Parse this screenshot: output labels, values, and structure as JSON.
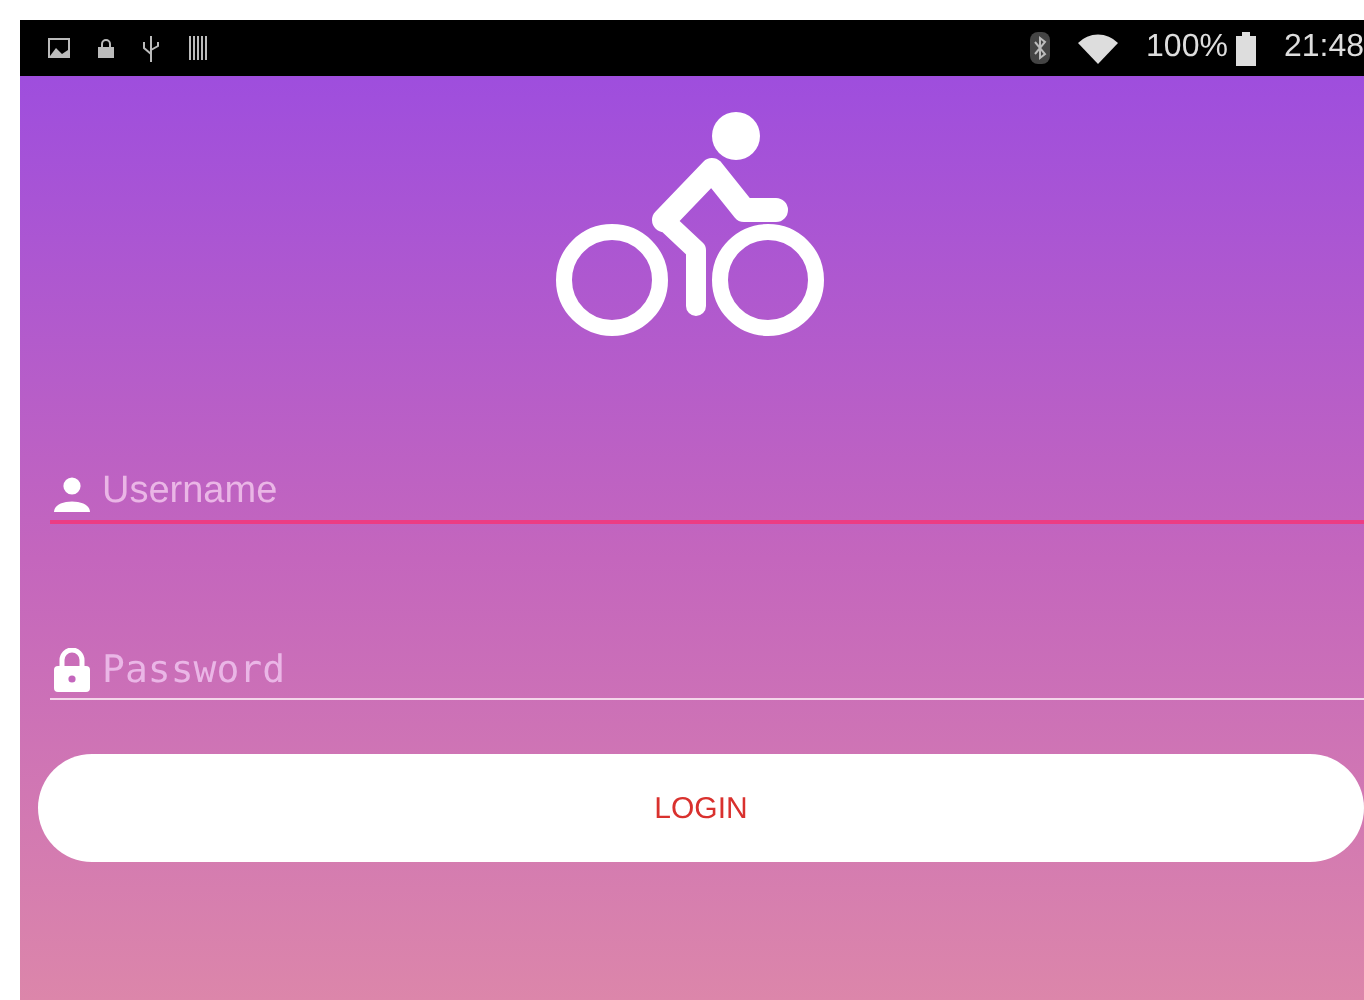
{
  "status_bar": {
    "battery": "100%",
    "time": "21:48"
  },
  "fields": [
    {
      "kind": "username",
      "placeholder": "Username",
      "focused": true
    },
    {
      "kind": "password",
      "placeholder": "Password",
      "focused": false
    }
  ],
  "login_button": {
    "label": "LOGIN"
  }
}
